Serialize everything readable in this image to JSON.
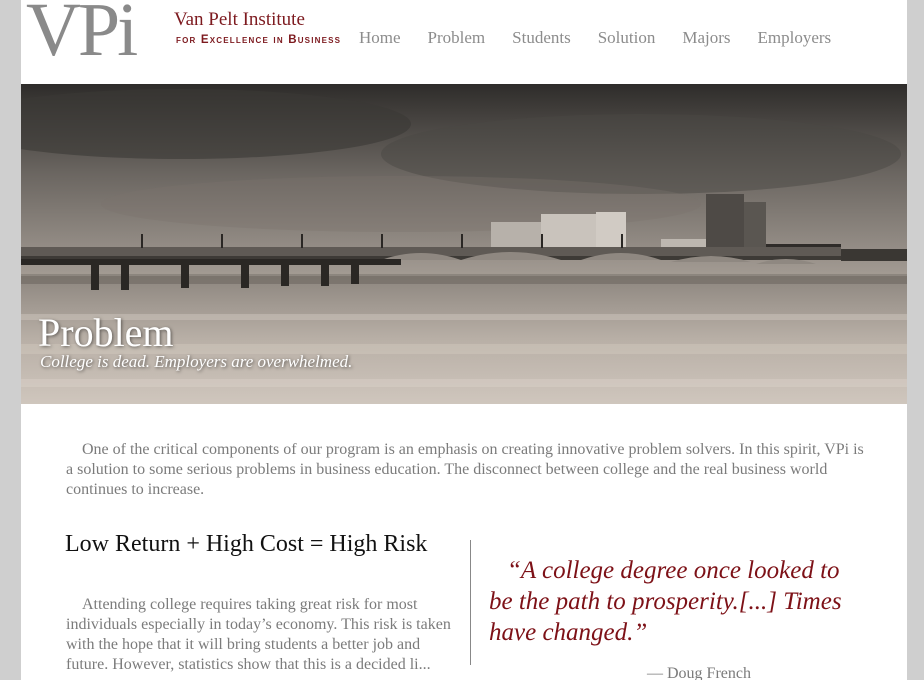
{
  "brand": {
    "logo_mark": "VPi",
    "name": "Van Pelt Institute",
    "tagline": "for Excellence in Business",
    "color": "#7d1a1f"
  },
  "nav": {
    "items": [
      {
        "label": "Home"
      },
      {
        "label": "Problem"
      },
      {
        "label": "Students"
      },
      {
        "label": "Solution"
      },
      {
        "label": "Majors"
      },
      {
        "label": "Employers"
      }
    ]
  },
  "hero": {
    "title": "Problem",
    "subtitle": "College is dead. Employers are overwhelmed."
  },
  "content": {
    "intro": "One of the critical components of our program is an emphasis on creating innovative problem solvers. In this spirit, VPi is a solution to some serious problems in business education. The disconnect between college and the real business world continues to increase.",
    "section_heading": "Low Return + High Cost = High Risk",
    "section_body": "Attending college requires taking great risk for most individuals especially in today’s economy. This risk is taken with the hope that it will bring students a better job and future. However, statistics show that this is a decided li..."
  },
  "quote": {
    "text": "“A college degree once looked to be the path to prosperity.[...] Times have changed.”",
    "author": "— Doug French",
    "color": "#7d1117"
  }
}
